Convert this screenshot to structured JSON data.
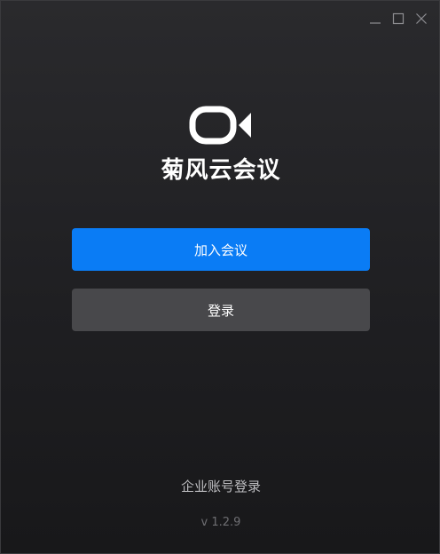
{
  "window_controls": {
    "minimize_icon": "minimize-icon",
    "maximize_icon": "maximize-icon",
    "close_icon": "close-icon"
  },
  "app": {
    "logo_icon": "video-camera-icon",
    "title": "菊风云会议"
  },
  "actions": {
    "join_label": "加入会议",
    "login_label": "登录"
  },
  "footer": {
    "enterprise_login": "企业账号登录",
    "version": "v 1.2.9"
  },
  "colors": {
    "background": "#1f1f22",
    "primary": "#0a7cf5",
    "secondary": "#48484b",
    "text": "#ffffff",
    "muted_text": "#bdbdc0",
    "version_text": "#6e6e72"
  }
}
